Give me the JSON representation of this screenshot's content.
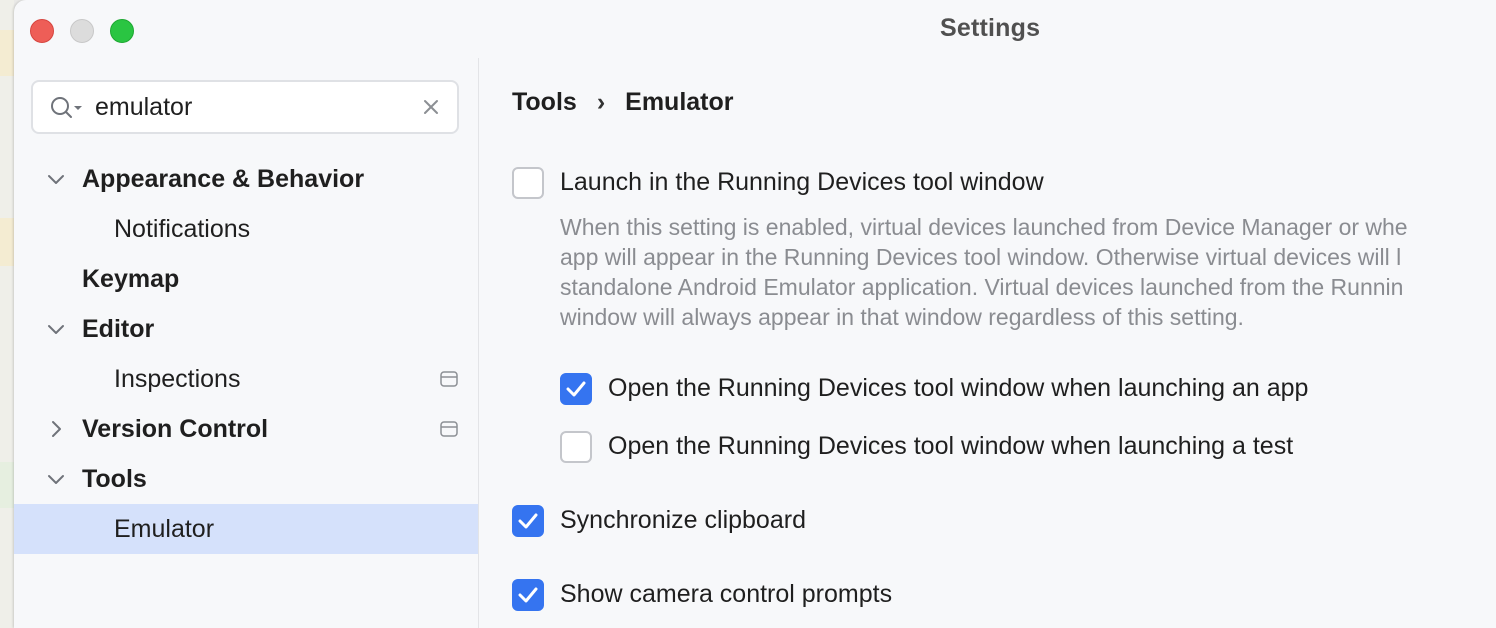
{
  "window": {
    "title": "Settings"
  },
  "search": {
    "value": "emulator"
  },
  "sidebar": {
    "items": [
      {
        "label": "Appearance & Behavior",
        "level": 0,
        "expanded": true
      },
      {
        "label": "Notifications",
        "level": 1
      },
      {
        "label": "Keymap",
        "level": 0
      },
      {
        "label": "Editor",
        "level": 0,
        "expanded": true
      },
      {
        "label": "Inspections",
        "level": 1,
        "badge": true
      },
      {
        "label": "Version Control",
        "level": 0,
        "expanded": false,
        "badge": true
      },
      {
        "label": "Tools",
        "level": 0,
        "expanded": true
      },
      {
        "label": "Emulator",
        "level": 1,
        "selected": true
      }
    ]
  },
  "breadcrumb": {
    "parent": "Tools",
    "separator": "›",
    "current": "Emulator"
  },
  "settings": {
    "launch_running_devices": {
      "label": "Launch in the Running Devices tool window",
      "checked": false
    },
    "launch_description": "When this setting is enabled, virtual devices launched from Device Manager or whe\napp will appear in the Running Devices tool window. Otherwise virtual devices will l\nstandalone Android Emulator application. Virtual devices launched from the Runnin\nwindow will always appear in that window regardless of this setting.",
    "open_when_app": {
      "label": "Open the Running Devices tool window when launching an app",
      "checked": true
    },
    "open_when_test": {
      "label": "Open the Running Devices tool window when launching a test",
      "checked": false
    },
    "sync_clipboard": {
      "label": "Synchronize clipboard",
      "checked": true
    },
    "camera_prompts": {
      "label": "Show camera control prompts",
      "checked": true
    }
  },
  "colors": {
    "accent": "#3574f0",
    "selection": "#d5e1fb"
  }
}
